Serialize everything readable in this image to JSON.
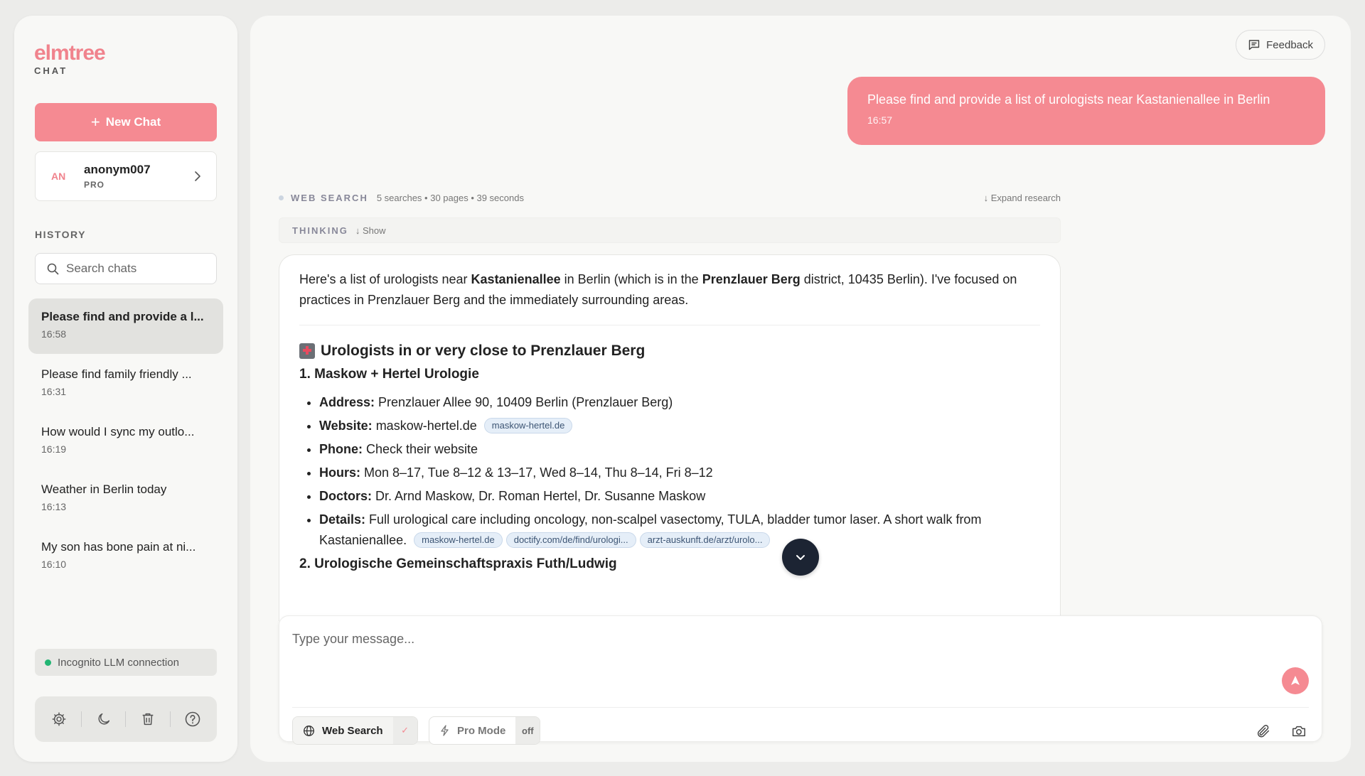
{
  "sidebar": {
    "logo": "elmtree",
    "logo_sub": "CHAT",
    "new_chat": "New Chat",
    "user": {
      "initials": "AN",
      "name": "anonym007",
      "plan": "PRO"
    },
    "history_label": "HISTORY",
    "search_placeholder": "Search chats",
    "history": [
      {
        "title": "Please find and provide a l...",
        "time": "16:58"
      },
      {
        "title": "Please find family friendly ...",
        "time": "16:31"
      },
      {
        "title": "How would I sync my outlo...",
        "time": "16:19"
      },
      {
        "title": "Weather in Berlin today",
        "time": "16:13"
      },
      {
        "title": "My son has bone pain at ni...",
        "time": "16:10"
      }
    ],
    "incognito": "Incognito LLM connection"
  },
  "main": {
    "feedback": "Feedback",
    "user_message": {
      "text": "Please find and provide a list of urologists near Kastanienallee in Berlin",
      "time": "16:57"
    },
    "research": {
      "label": "WEB SEARCH",
      "stats": "5 searches • 30 pages • 39 seconds",
      "expand": "↓ Expand research"
    },
    "thinking": {
      "label": "THINKING",
      "show": "↓ Show"
    },
    "answer": {
      "intro_1": "Here's a list of urologists near ",
      "intro_b1": "Kastanienallee",
      "intro_2": " in Berlin (which is in the ",
      "intro_b2": "Prenzlauer Berg",
      "intro_3": " district, 10435 Berlin). I've focused on practices in Prenzlauer Berg and the immediately surrounding areas.",
      "heading": "Urologists in or very close to Prenzlauer Berg",
      "practice1": "1. Maskow + Hertel Urologie",
      "items": [
        {
          "label": "Address:",
          "text": " Prenzlauer Allee 90, 10409 Berlin (Prenzlauer Berg)"
        },
        {
          "label": "Website:",
          "text": " maskow-hertel.de",
          "chip": "maskow-hertel.de"
        },
        {
          "label": "Phone:",
          "text": " Check their website"
        },
        {
          "label": "Hours:",
          "text": " Mon 8–17, Tue 8–12 & 13–17, Wed 8–14, Thu 8–14, Fri 8–12"
        },
        {
          "label": "Doctors:",
          "text": " Dr. Arnd Maskow, Dr. Roman Hertel, Dr. Susanne Maskow"
        },
        {
          "label": "Details:",
          "text": " Full urological care including oncology, non-scalpel vasectomy, TULA, bladder tumor laser. A short walk from Kastanienallee.",
          "chips": [
            "maskow-hertel.de",
            "doctify.com/de/find/urologi...",
            "arzt-auskunft.de/arzt/urolo..."
          ]
        }
      ],
      "practice2": "2. Urologische Gemeinschaftspraxis Futh/Ludwig"
    },
    "composer": {
      "placeholder": "Type your message...",
      "web_search": "Web Search",
      "web_state": "✓",
      "pro_mode": "Pro Mode",
      "pro_state": "off"
    }
  },
  "colors": {
    "accent": "#f58a92",
    "brand": "#f0838d",
    "scroll_button": "#1c2433",
    "online": "#22b573"
  }
}
